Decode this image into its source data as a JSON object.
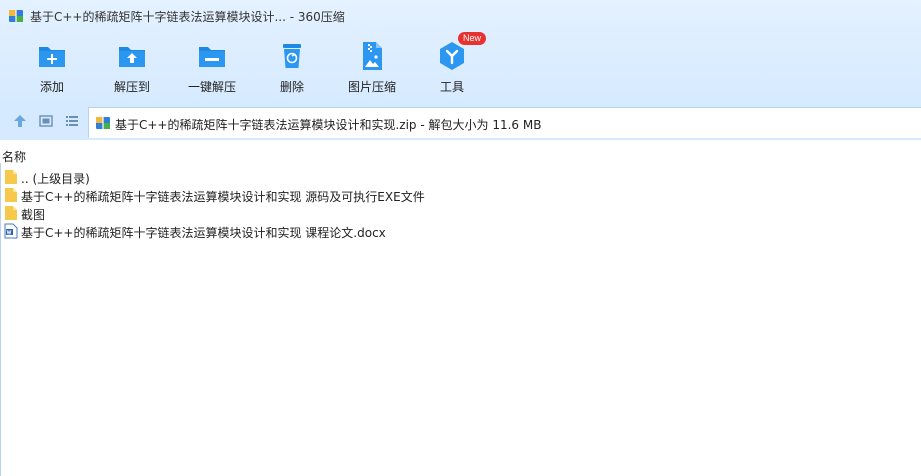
{
  "window": {
    "title": "基于C++的稀疏矩阵十字链表法运算模块设计... - 360压缩"
  },
  "toolbar": {
    "items": [
      {
        "label": "添加",
        "icon": "add-folder-icon"
      },
      {
        "label": "解压到",
        "icon": "extract-to-icon"
      },
      {
        "label": "一键解压",
        "icon": "one-click-extract-icon"
      },
      {
        "label": "删除",
        "icon": "trash-icon"
      },
      {
        "label": "图片压缩",
        "icon": "image-compress-icon"
      },
      {
        "label": "工具",
        "icon": "tools-icon"
      }
    ],
    "badge": "New"
  },
  "address": {
    "text": "基于C++的稀疏矩阵十字链表法运算模块设计和实现.zip - 解包大小为 11.6 MB"
  },
  "list": {
    "column_name": "名称",
    "rows": [
      {
        "label": ".. (上级目录)",
        "icon": "folder-icon"
      },
      {
        "label": "基于C++的稀疏矩阵十字链表法运算模块设计和实现 源码及可执行EXE文件",
        "icon": "folder-icon"
      },
      {
        "label": "截图",
        "icon": "folder-icon"
      },
      {
        "label": "基于C++的稀疏矩阵十字链表法运算模块设计和实现 课程论文.docx",
        "icon": "word-doc-icon"
      }
    ]
  },
  "colors": {
    "accent": "#1e88e5",
    "band": "#d6eaff",
    "folder": "#f7c94b",
    "badge": "#e8322f"
  }
}
